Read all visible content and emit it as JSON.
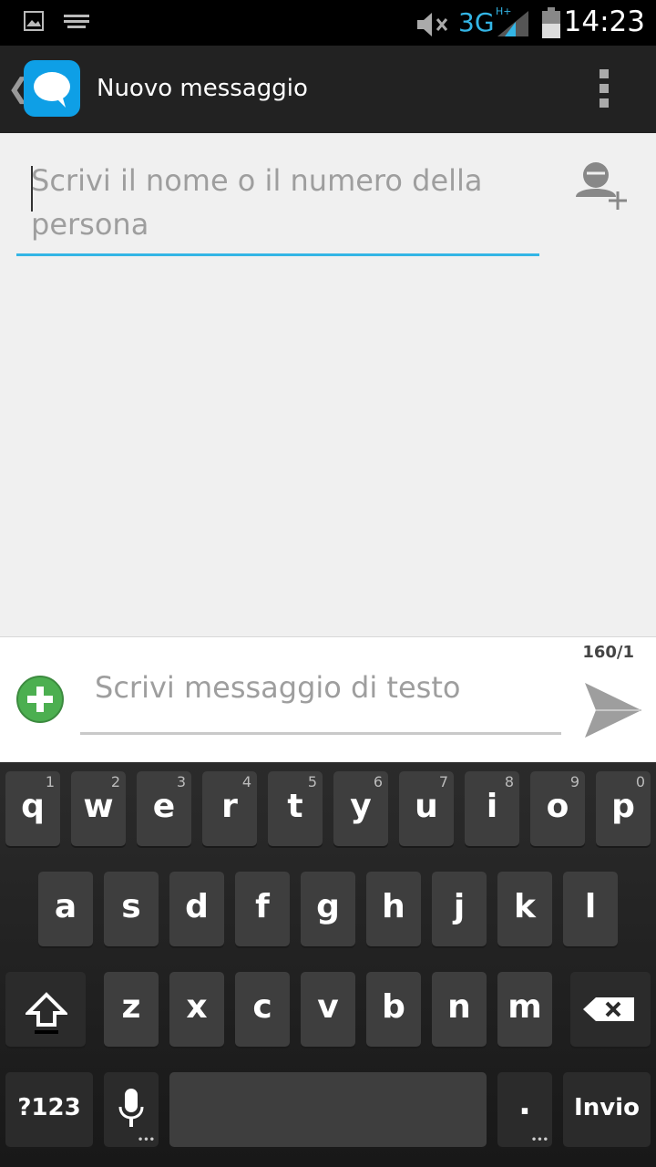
{
  "status_bar": {
    "time": "14:23",
    "network": "3G",
    "network_sup": "H+"
  },
  "action_bar": {
    "title": "Nuovo messaggio"
  },
  "recipient": {
    "placeholder": "Scrivi il nome o il numero della persona"
  },
  "compose": {
    "counter": "160/1",
    "placeholder": "Scrivi messaggio di testo"
  },
  "keyboard": {
    "row1": [
      {
        "label": "q",
        "num": "1"
      },
      {
        "label": "w",
        "num": "2"
      },
      {
        "label": "e",
        "num": "3"
      },
      {
        "label": "r",
        "num": "4"
      },
      {
        "label": "t",
        "num": "5"
      },
      {
        "label": "y",
        "num": "6"
      },
      {
        "label": "u",
        "num": "7"
      },
      {
        "label": "i",
        "num": "8"
      },
      {
        "label": "o",
        "num": "9"
      },
      {
        "label": "p",
        "num": "0"
      }
    ],
    "row2": [
      "a",
      "s",
      "d",
      "f",
      "g",
      "h",
      "j",
      "k",
      "l"
    ],
    "row3": [
      "z",
      "x",
      "c",
      "v",
      "b",
      "n",
      "m"
    ],
    "symbols_label": "?123",
    "period_label": ".",
    "enter_label": "Invio"
  },
  "colors": {
    "accent": "#33b5e5",
    "actionbar": "#222222",
    "logo": "#0e9fe6"
  }
}
